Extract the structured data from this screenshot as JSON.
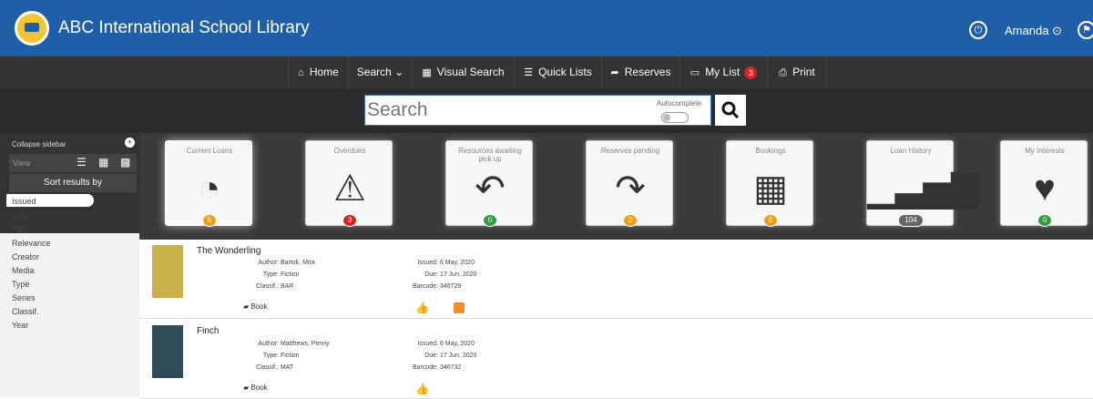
{
  "header": {
    "title": "ABC International School Library",
    "user": "Amanda"
  },
  "nav": {
    "items": [
      {
        "label": "Home",
        "icon": "home-icon"
      },
      {
        "label": "Search",
        "icon": "chevron-down-icon"
      },
      {
        "label": "Visual Search",
        "icon": "grid-icon"
      },
      {
        "label": "Quick Lists",
        "icon": "list-icon"
      },
      {
        "label": "Reserves",
        "icon": "share-icon"
      },
      {
        "label": "My List",
        "icon": "card-icon",
        "badge": "3"
      },
      {
        "label": "Print",
        "icon": "print-icon"
      }
    ]
  },
  "search": {
    "placeholder": "Search",
    "autocomplete_label": "Autocomplete"
  },
  "sidebar": {
    "collapse": "Collapse sidebar",
    "view": "View",
    "sort_title": "Sort results by",
    "sort_items": [
      "Issued",
      "Due",
      "Title",
      "Relevance",
      "Creator",
      "Media",
      "Type",
      "Series",
      "Classif.",
      "Year"
    ]
  },
  "dashboard": {
    "tiles": [
      {
        "label": "Current Loans",
        "count": "5",
        "icon": "gauge-icon",
        "color": "#f39c12"
      },
      {
        "label": "Overdues",
        "count": "3",
        "icon": "warning-icon",
        "color": "#d9211e"
      },
      {
        "label": "Resources awaiting pick up",
        "count": "0",
        "icon": "reply-icon",
        "color": "#2e9e3a"
      },
      {
        "label": "Reserves pending",
        "count": "2",
        "icon": "forward-icon",
        "color": "#f39c12"
      },
      {
        "label": "Bookings",
        "count": "0",
        "icon": "calendar-icon",
        "color": "#f39c12"
      },
      {
        "label": "Loan History",
        "count": "104",
        "icon": "signal-icon",
        "color": "#666666"
      },
      {
        "label": "My Interests",
        "count": "0",
        "icon": "heart-icon",
        "color": "#2e9e3a"
      }
    ]
  },
  "results": [
    {
      "title": "The Wonderling",
      "author": "Bartok, Mira",
      "type": "Fiction",
      "classif": "BAR",
      "issued": "6 May, 2020",
      "due": "17 Jun, 2020",
      "barcode": "346729",
      "media": "Book",
      "cover_color": "#c9b04a"
    },
    {
      "title": "Finch",
      "author": "Matthews, Penny",
      "type": "Fiction",
      "classif": "MAT",
      "issued": "6 May, 2020",
      "due": "17 Jun, 2020",
      "barcode": "346732",
      "media": "Book",
      "cover_color": "#2f4b57"
    }
  ],
  "labels": {
    "author": "Author:",
    "type": "Type:",
    "classif": "Classif.:",
    "issued": "Issued:",
    "due": "Due:",
    "barcode": "Barcode:"
  }
}
